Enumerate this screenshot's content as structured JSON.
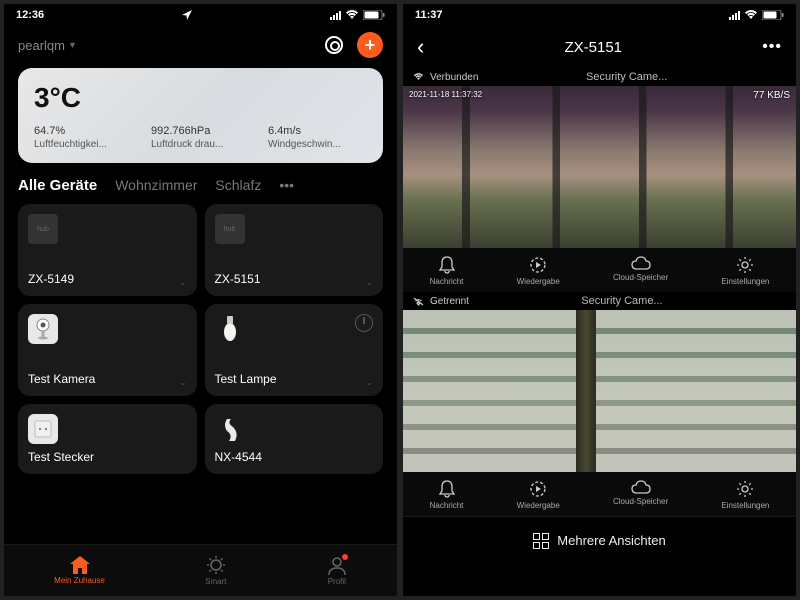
{
  "left": {
    "status": {
      "time": "12:36"
    },
    "header": {
      "home_name": "pearlqm"
    },
    "weather": {
      "temp": "3°C",
      "items": [
        {
          "value": "64.7%",
          "label": "Luftfeuchtigkei..."
        },
        {
          "value": "992.766hPa",
          "label": "Luftdruck drau..."
        },
        {
          "value": "6.4m/s",
          "label": "Windgeschwin..."
        }
      ]
    },
    "rooms": [
      "Alle Geräte",
      "Wohnzimmer",
      "Schlafz"
    ],
    "devices": [
      {
        "label": "ZX-5149"
      },
      {
        "label": "ZX-5151"
      },
      {
        "label": "Test Kamera"
      },
      {
        "label": "Test Lampe"
      },
      {
        "label": "Test Stecker"
      },
      {
        "label": "NX-4544"
      }
    ],
    "nav": {
      "home": "Mein Zuhause",
      "smart": "Smart",
      "profile": "Profil"
    }
  },
  "right": {
    "status": {
      "time": "11:37"
    },
    "header": {
      "title": "ZX-5151"
    },
    "cam1": {
      "conn": "Verbunden",
      "name": "Security Came...",
      "timestamp": "2021-11-18 11:37:32",
      "rate": "77 KB/S"
    },
    "cam2": {
      "conn": "Getrennt",
      "name": "Security Came..."
    },
    "actions": {
      "msg": "Nachricht",
      "play": "Wiedergabe",
      "cloud": "Cloud-Speicher",
      "settings": "Einstellungen"
    },
    "multi": "Mehrere Ansichten"
  }
}
